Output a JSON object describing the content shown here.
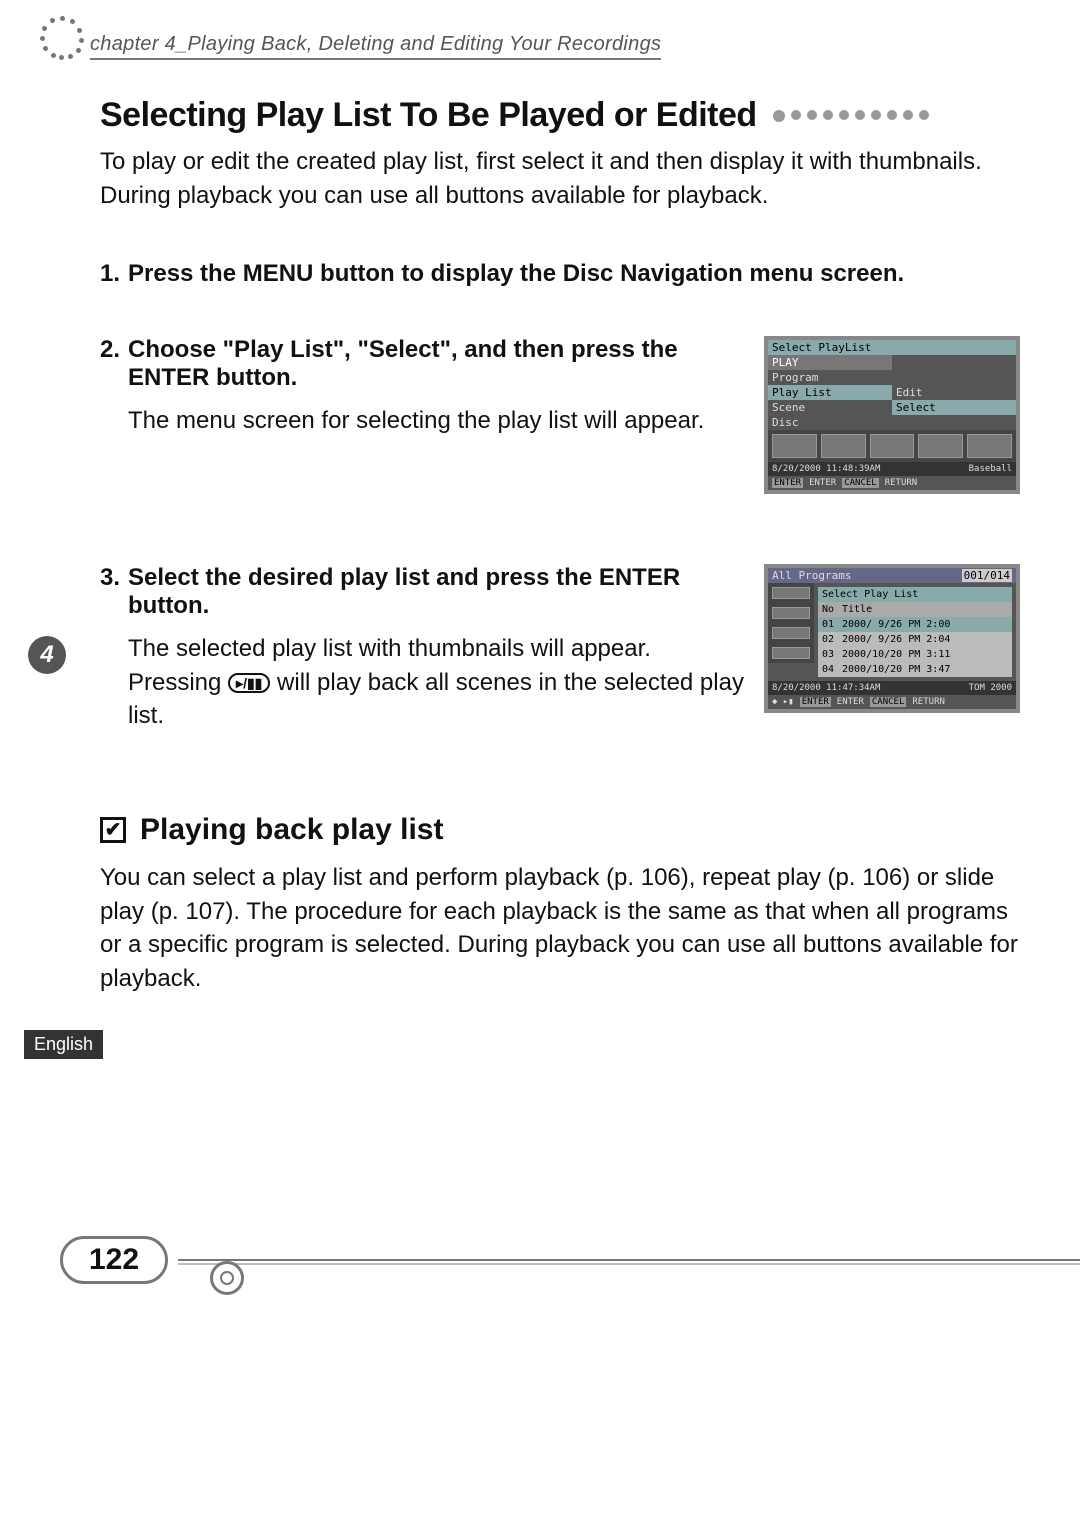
{
  "chapter_header": "chapter 4_Playing Back, Deleting and Editing Your Recordings",
  "section_title": "Selecting Play List To Be Played or Edited",
  "intro": "To play or edit the created play list, first select it and then display it with thumbnails. During playback you can use all buttons available for playback.",
  "steps": {
    "s1": {
      "num": "1.",
      "head": "Press the MENU button to display the Disc Navigation menu screen."
    },
    "s2": {
      "num": "2.",
      "head": "Choose \"Play List\", \"Select\", and then press the ENTER button.",
      "body": "The menu screen for selecting the play list will appear."
    },
    "s3": {
      "num": "3.",
      "head": "Select the desired play list and press the ENTER button.",
      "body_a": "The selected play list with thumbnails will appear. Pressing ",
      "body_b": " will play back all scenes in the selected play list."
    }
  },
  "subhead": "Playing back play list",
  "subpara": "You can select a play list and perform playback (p. 106), repeat play (p. 106) or slide play (p. 107). The procedure for each playback is the same as that when all programs or a specific program is selected. During playback you can use all buttons available for playback.",
  "lang": "English",
  "page_number": "122",
  "chapter_tab": "4",
  "screenshot1": {
    "title": "Select PlayList",
    "menu": [
      "PLAY",
      "Program",
      "Play List",
      "Scene",
      "Disc"
    ],
    "submenu": [
      "Edit",
      "Select"
    ],
    "timestamp": "8/20/2000 11:48:39AM",
    "program": "Baseball",
    "foot_enter_lbl": "ENTER",
    "foot_enter": "ENTER",
    "foot_cancel_lbl": "CANCEL",
    "foot_cancel": "RETURN"
  },
  "screenshot2": {
    "title": "All Programs",
    "counter": "001/014",
    "panel_title": "Select Play List",
    "col_no": "No",
    "col_title": "Title",
    "rows": [
      {
        "no": "01",
        "title": "2000/ 9/26 PM 2:00"
      },
      {
        "no": "02",
        "title": "2000/ 9/26 PM 2:04"
      },
      {
        "no": "03",
        "title": "2000/10/20 PM 3:11"
      },
      {
        "no": "04",
        "title": "2000/10/20 PM 3:47"
      }
    ],
    "timestamp": "8/20/2000 11:47:34AM",
    "program": "TOM 2000",
    "foot_enter_lbl": "ENTER",
    "foot_enter": "ENTER",
    "foot_cancel_lbl": "CANCEL",
    "foot_cancel": "RETURN"
  }
}
